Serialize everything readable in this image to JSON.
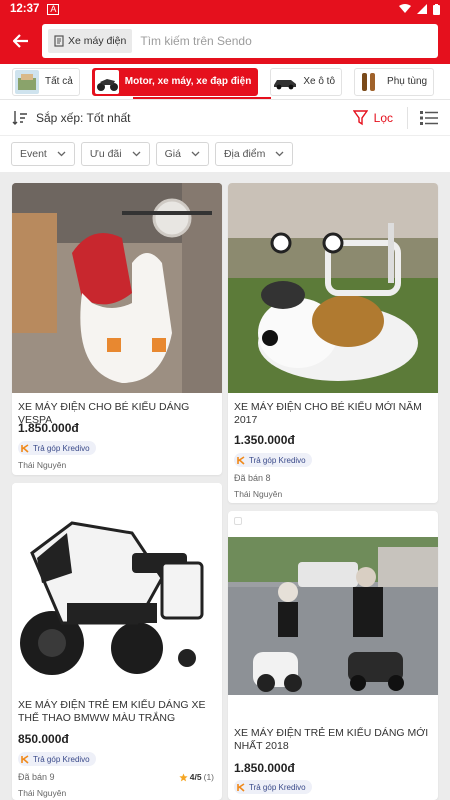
{
  "status": {
    "time": "12:37",
    "notif": "A"
  },
  "header": {
    "search_chip": "Xe máy điện",
    "search_placeholder": "Tìm kiếm trên Sendo"
  },
  "categories": [
    {
      "label": "Tất cả"
    },
    {
      "label": "Motor, xe máy, xe đạp điện",
      "active": true
    },
    {
      "label": "Xe ô tô"
    },
    {
      "label": "Phụ tùng"
    }
  ],
  "sort": {
    "label": "Sắp xếp: Tốt nhất",
    "filter_label": "Lọc"
  },
  "filters": [
    {
      "label": "Event"
    },
    {
      "label": "Ưu đãi"
    },
    {
      "label": "Giá"
    },
    {
      "label": "Địa điểm"
    }
  ],
  "products": [
    {
      "title": "XE MÁY ĐIỆN CHO BÉ  KIỂU DÁNG VESPA",
      "price": "1.850.000đ",
      "installment": "Trả góp Kredivo",
      "location": "Thái Nguyên"
    },
    {
      "title": "XE MÁY ĐIỆN CHO BÉ KIỂU MỚI NĂM 2017",
      "price": "1.350.000đ",
      "installment": "Trả góp Kredivo",
      "sold": "Đã bán 8",
      "location": "Thái Nguyên"
    },
    {
      "title": "XE MÁY ĐIỆN TRẺ EM KIỂU DÁNG XE THỂ THAO BMWW MÀU TRẮNG",
      "price": "850.000đ",
      "installment": "Trả góp Kredivo",
      "sold": "Đã bán 9",
      "rating": "4/5",
      "rating_count": "(1)",
      "location": "Thái Nguyên"
    },
    {
      "title": "XE MÁY ĐIỆN TRẺ EM KIỂU DÁNG MỚI NHẤT 2018",
      "price": "1.850.000đ",
      "installment": "Trả góp Kredivo"
    }
  ],
  "colors": {
    "accent": "#e5101d",
    "background": "#ececec"
  }
}
